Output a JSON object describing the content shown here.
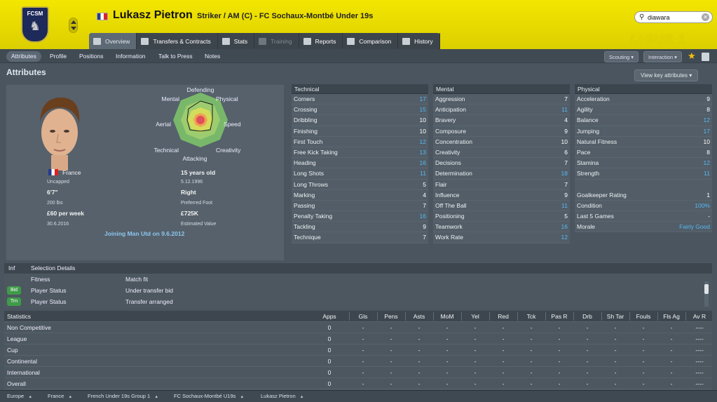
{
  "header": {
    "club_badge_text": "FCSM",
    "player_name": "Lukasz Pietron",
    "player_role": "Striker / AM (C) - FC Sochaux-Montbé Under 19s",
    "search_value": "diawara",
    "league_logo": "LIGUE 1"
  },
  "tabs": [
    {
      "label": "Overview",
      "icon": "overview-icon"
    },
    {
      "label": "Transfers & Contracts",
      "icon": "transfers-icon"
    },
    {
      "label": "Stats",
      "icon": "stats-icon"
    },
    {
      "label": "Training",
      "icon": "training-icon"
    },
    {
      "label": "Reports",
      "icon": "reports-icon"
    },
    {
      "label": "Comparison",
      "icon": "comparison-icon"
    },
    {
      "label": "History",
      "icon": "history-icon"
    }
  ],
  "subnav": {
    "items": [
      "Attributes",
      "Profile",
      "Positions",
      "Information",
      "Talk to Press",
      "Notes"
    ],
    "scouting": "Scouting",
    "interaction": "Interaction"
  },
  "page": {
    "title": "Attributes",
    "view_key": "View key attributes"
  },
  "profile": {
    "radar_labels": {
      "defending": "Defending",
      "physical": "Physical",
      "speed": "Speed",
      "creativity": "Creativity",
      "attacking": "Attacking",
      "technical": "Technical",
      "aerial": "Aerial",
      "mental": "Mental"
    },
    "nationality": "France",
    "caps": "Uncapped",
    "height": "6'7\"",
    "weight": "200 lbs",
    "wage": "£60 per week",
    "contract_end": "30.6.2016",
    "age": "15 years old",
    "dob": "5.12.1996",
    "foot": "Right",
    "foot_label": "Preferred Foot",
    "value": "£725K",
    "value_label": "Estimated Value",
    "joining": "Joining Man Utd on 9.6.2012"
  },
  "technical": {
    "title": "Technical",
    "rows": [
      {
        "name": "Corners",
        "value": "17",
        "hi": true
      },
      {
        "name": "Crossing",
        "value": "15",
        "hi": true
      },
      {
        "name": "Dribbling",
        "value": "10",
        "hi": false
      },
      {
        "name": "Finishing",
        "value": "10",
        "hi": false
      },
      {
        "name": "First Touch",
        "value": "12",
        "hi": true
      },
      {
        "name": "Free Kick Taking",
        "value": "13",
        "hi": true
      },
      {
        "name": "Heading",
        "value": "16",
        "hi": true
      },
      {
        "name": "Long Shots",
        "value": "11",
        "hi": true
      },
      {
        "name": "Long Throws",
        "value": "5",
        "hi": false
      },
      {
        "name": "Marking",
        "value": "4",
        "hi": false
      },
      {
        "name": "Passing",
        "value": "7",
        "hi": false
      },
      {
        "name": "Penalty Taking",
        "value": "16",
        "hi": true
      },
      {
        "name": "Tackling",
        "value": "9",
        "hi": false
      },
      {
        "name": "Technique",
        "value": "7",
        "hi": false
      }
    ]
  },
  "mental": {
    "title": "Mental",
    "rows": [
      {
        "name": "Aggression",
        "value": "7",
        "hi": false
      },
      {
        "name": "Anticipation",
        "value": "11",
        "hi": true
      },
      {
        "name": "Bravery",
        "value": "4",
        "hi": false
      },
      {
        "name": "Composure",
        "value": "9",
        "hi": false
      },
      {
        "name": "Concentration",
        "value": "10",
        "hi": false
      },
      {
        "name": "Creativity",
        "value": "6",
        "hi": false
      },
      {
        "name": "Decisions",
        "value": "7",
        "hi": false
      },
      {
        "name": "Determination",
        "value": "18",
        "hi": true
      },
      {
        "name": "Flair",
        "value": "7",
        "hi": false
      },
      {
        "name": "Influence",
        "value": "9",
        "hi": false
      },
      {
        "name": "Off The Ball",
        "value": "11",
        "hi": true
      },
      {
        "name": "Positioning",
        "value": "5",
        "hi": false
      },
      {
        "name": "Teamwork",
        "value": "16",
        "hi": true
      },
      {
        "name": "Work Rate",
        "value": "12",
        "hi": true
      }
    ]
  },
  "physical": {
    "title": "Physical",
    "rows": [
      {
        "name": "Acceleration",
        "value": "9",
        "hi": false
      },
      {
        "name": "Agility",
        "value": "8",
        "hi": false
      },
      {
        "name": "Balance",
        "value": "12",
        "hi": true
      },
      {
        "name": "Jumping",
        "value": "17",
        "hi": true
      },
      {
        "name": "Natural Fitness",
        "value": "10",
        "hi": false
      },
      {
        "name": "Pace",
        "value": "8",
        "hi": false
      },
      {
        "name": "Stamina",
        "value": "12",
        "hi": true
      },
      {
        "name": "Strength",
        "value": "11",
        "hi": true
      }
    ],
    "extra": [
      {
        "name": "Goalkeeper Rating",
        "value": "1",
        "hi": false
      },
      {
        "name": "Condition",
        "value": "100%",
        "hi": true
      },
      {
        "name": "Last 5 Games",
        "value": "-",
        "hi": false
      },
      {
        "name": "Morale",
        "value": "Fairly Good",
        "hi": true
      }
    ]
  },
  "details": {
    "col1": "Inf",
    "col2": "Selection Details",
    "rows": [
      {
        "badge": "",
        "label": "Fitness",
        "value": "Match fit"
      },
      {
        "badge": "Bid",
        "label": "Player Status",
        "value": "Under transfer bid"
      },
      {
        "badge": "Trn",
        "label": "Player Status",
        "value": "Transfer arranged"
      }
    ]
  },
  "stats": {
    "title": "Statistics",
    "columns": [
      "Apps",
      "Gls",
      "Pens",
      "Asts",
      "MoM",
      "Yel",
      "Red",
      "Tck",
      "Pas R",
      "Drb",
      "Sh Tar",
      "Fouls",
      "Fls Ag",
      "Av R"
    ],
    "rows": [
      {
        "name": "Non Competitive",
        "cells": [
          "0",
          "-",
          "-",
          "-",
          "-",
          "-",
          "-",
          "-",
          "-",
          "-",
          "-",
          "-",
          "-",
          "----"
        ]
      },
      {
        "name": "League",
        "cells": [
          "0",
          "-",
          "-",
          "-",
          "-",
          "-",
          "-",
          "-",
          "-",
          "-",
          "-",
          "-",
          "-",
          "----"
        ]
      },
      {
        "name": "Cup",
        "cells": [
          "0",
          "-",
          "-",
          "-",
          "-",
          "-",
          "-",
          "-",
          "-",
          "-",
          "-",
          "-",
          "-",
          "----"
        ]
      },
      {
        "name": "Continental",
        "cells": [
          "0",
          "-",
          "-",
          "-",
          "-",
          "-",
          "-",
          "-",
          "-",
          "-",
          "-",
          "-",
          "-",
          "----"
        ]
      },
      {
        "name": "International",
        "cells": [
          "0",
          "-",
          "-",
          "-",
          "-",
          "-",
          "-",
          "-",
          "-",
          "-",
          "-",
          "-",
          "-",
          "----"
        ]
      },
      {
        "name": "Overall",
        "cells": [
          "0",
          "-",
          "-",
          "-",
          "-",
          "-",
          "-",
          "-",
          "-",
          "-",
          "-",
          "-",
          "-",
          "----"
        ]
      }
    ]
  },
  "statusbar": [
    "Europe",
    "France",
    "French Under 19s Group 1",
    "FC Sochaux-Montbé U19s",
    "Lukasz Pietron"
  ],
  "colors": {
    "header_yellow": "#f3e600",
    "highlight_blue": "#58b8f0",
    "badge_green": "#3f9b49"
  }
}
